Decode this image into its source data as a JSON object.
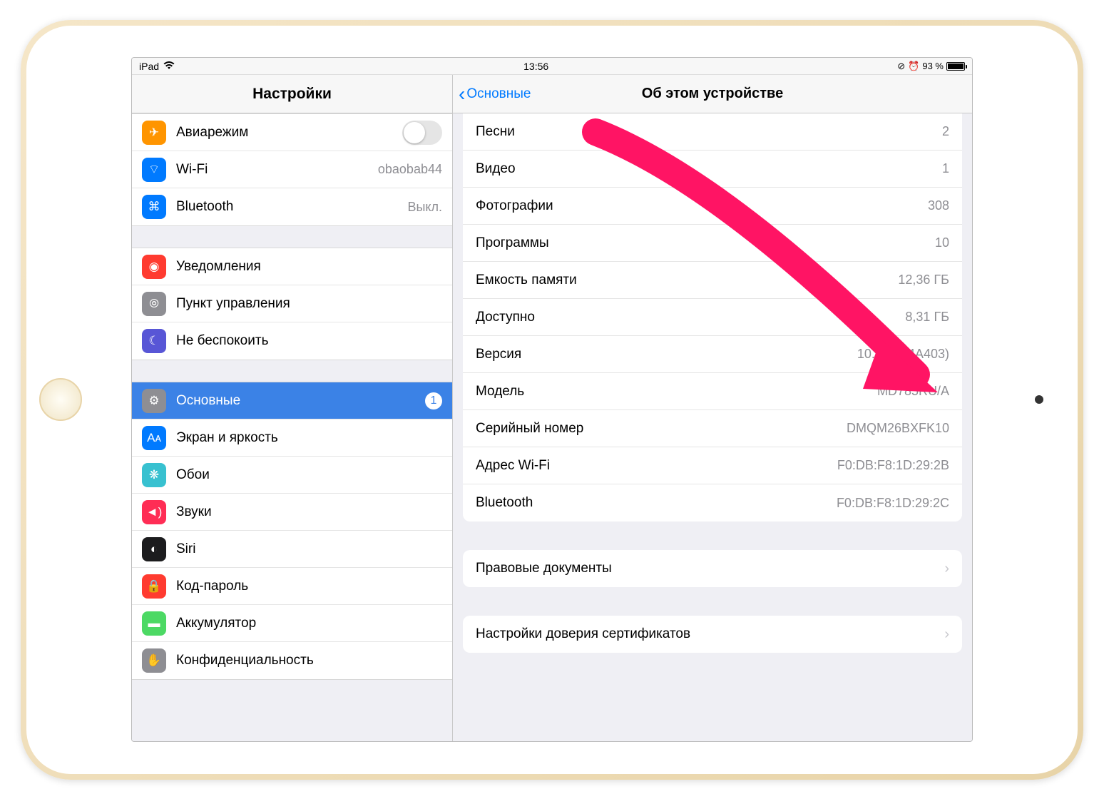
{
  "statusbar": {
    "device": "iPad",
    "time": "13:56",
    "battery": "93 %"
  },
  "sidebar": {
    "title": "Настройки",
    "groups": [
      [
        {
          "id": "airplane",
          "label": "Авиарежим",
          "icon_bg": "#ff9500",
          "type": "toggle"
        },
        {
          "id": "wifi",
          "label": "Wi-Fi",
          "icon_bg": "#007aff",
          "value": "obaobab44"
        },
        {
          "id": "bluetooth",
          "label": "Bluetooth",
          "icon_bg": "#007aff",
          "value": "Выкл."
        }
      ],
      [
        {
          "id": "notifications",
          "label": "Уведомления",
          "icon_bg": "#ff3b30"
        },
        {
          "id": "controlcenter",
          "label": "Пункт управления",
          "icon_bg": "#8e8e93"
        },
        {
          "id": "dnd",
          "label": "Не беспокоить",
          "icon_bg": "#5856d6"
        }
      ],
      [
        {
          "id": "general",
          "label": "Основные",
          "icon_bg": "#8e8e93",
          "selected": true,
          "badge": "1"
        },
        {
          "id": "display",
          "label": "Экран и яркость",
          "icon_bg": "#007aff"
        },
        {
          "id": "wallpaper",
          "label": "Обои",
          "icon_bg": "#38c1d0"
        },
        {
          "id": "sounds",
          "label": "Звуки",
          "icon_bg": "#ff2d55"
        },
        {
          "id": "siri",
          "label": "Siri",
          "icon_bg": "#1c1c1e"
        },
        {
          "id": "passcode",
          "label": "Код-пароль",
          "icon_bg": "#ff3b30"
        },
        {
          "id": "battery",
          "label": "Аккумулятор",
          "icon_bg": "#4cd964"
        },
        {
          "id": "privacy",
          "label": "Конфиденциальность",
          "icon_bg": "#8e8e93"
        }
      ]
    ]
  },
  "detail": {
    "back": "Основные",
    "title": "Об этом устройстве",
    "rows": [
      {
        "label": "Песни",
        "value": "2"
      },
      {
        "label": "Видео",
        "value": "1"
      },
      {
        "label": "Фотографии",
        "value": "308"
      },
      {
        "label": "Программы",
        "value": "10"
      },
      {
        "label": "Емкость памяти",
        "value": "12,36 ГБ"
      },
      {
        "label": "Доступно",
        "value": "8,31 ГБ"
      },
      {
        "label": "Версия",
        "value": "10.0.1 (14A403)"
      },
      {
        "label": "Модель",
        "value": "MD785RU/A"
      },
      {
        "label": "Серийный номер",
        "value": "DMQM26BXFK10"
      },
      {
        "label": "Адрес Wi-Fi",
        "value": "F0:DB:F8:1D:29:2B"
      },
      {
        "label": "Bluetooth",
        "value": "F0:DB:F8:1D:29:2C"
      }
    ],
    "legal": "Правовые документы",
    "cert": "Настройки доверия сертификатов"
  },
  "icons": {
    "airplane": "✈",
    "wifi": "⌔",
    "bluetooth": "⌘",
    "notifications": "◉",
    "controlcenter": "⦾",
    "dnd": "☾",
    "general": "⚙",
    "display": "Aᴀ",
    "wallpaper": "❋",
    "sounds": "◄)",
    "siri": "◐",
    "passcode": "🔒",
    "battery": "▬",
    "privacy": "✋"
  }
}
